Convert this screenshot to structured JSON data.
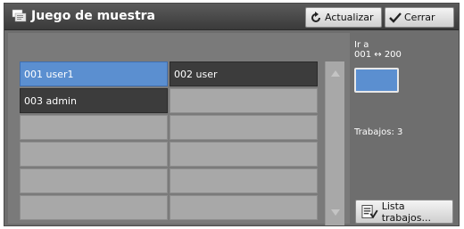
{
  "header": {
    "title": "Juego de muestra",
    "refresh_label": "Actualizar",
    "close_label": "Cerrar"
  },
  "users": [
    {
      "label": "001  user1",
      "state": "selected"
    },
    {
      "label": "002  user",
      "state": "filled"
    },
    {
      "label": "003  admin",
      "state": "filled"
    },
    {
      "label": "",
      "state": "empty"
    },
    {
      "label": "",
      "state": "empty"
    },
    {
      "label": "",
      "state": "empty"
    },
    {
      "label": "",
      "state": "empty"
    },
    {
      "label": "",
      "state": "empty"
    },
    {
      "label": "",
      "state": "empty"
    },
    {
      "label": "",
      "state": "empty"
    },
    {
      "label": "",
      "state": "empty"
    },
    {
      "label": "",
      "state": "empty"
    }
  ],
  "side": {
    "goto_line1": "Ir a",
    "goto_line2": "001 ↔ 200",
    "jobs_text": "Trabajos: 3",
    "joblist_label": "Lista trabajos..."
  },
  "colors": {
    "selected": "#5b8fd0",
    "filled": "#3c3c3c",
    "empty": "#a8a8a8"
  }
}
